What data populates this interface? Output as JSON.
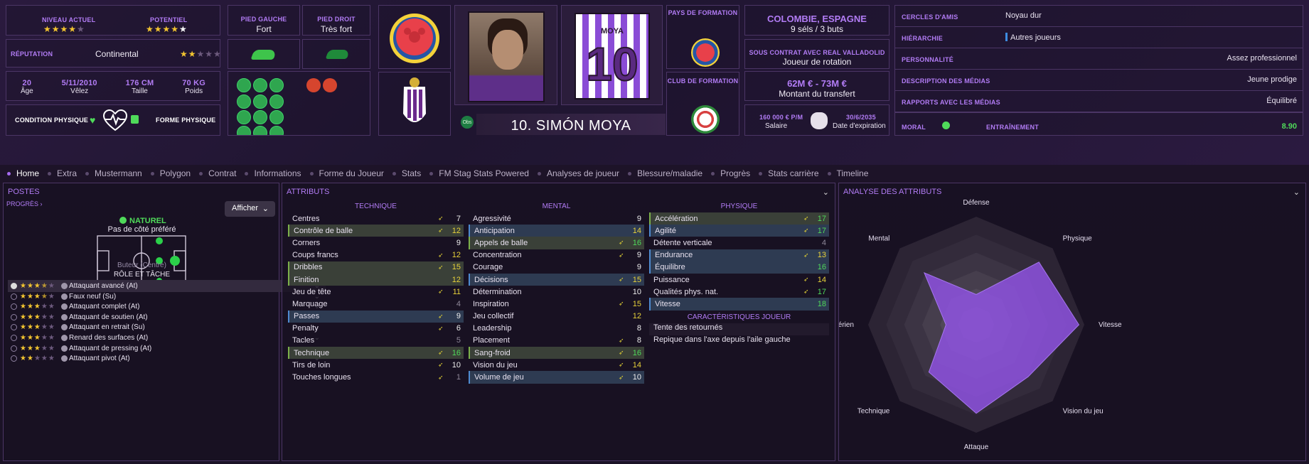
{
  "player": {
    "name": "10. SIMÓN MOYA",
    "shirt_name": "MOYA",
    "shirt_number": "10",
    "obs": "Obs"
  },
  "ability": {
    "current_label": "NIVEAU ACTUEL",
    "current_stars": 3.5,
    "potential_label": "POTENTIEL",
    "potential_stars": 4.5
  },
  "reputation": {
    "label": "RÉPUTATION",
    "value": "Continental",
    "stars": 2.5
  },
  "bio": [
    {
      "value": "20",
      "label": "Âge"
    },
    {
      "value": "5/11/2010",
      "label": "Vêlez"
    },
    {
      "value": "176 CM",
      "label": "Taille"
    },
    {
      "value": "70 KG",
      "label": "Poids"
    }
  ],
  "condition": {
    "label": "CONDITION PHYSIQUE",
    "form_label": "FORME PHYSIQUE"
  },
  "feet": {
    "left_label": "PIED GAUCHE",
    "left_value": "Fort",
    "right_label": "PIED DROIT",
    "right_value": "Très fort"
  },
  "training": {
    "country_label": "PAYS DE FORMATION",
    "club_label": "CLUB DE FORMATION"
  },
  "international": {
    "nation": "COLOMBIE, ESPAGNE",
    "caps": "9 séls / 3 buts"
  },
  "contract": {
    "title": "SOUS CONTRAT AVEC REAL VALLADOLID",
    "role": "Joueur de rotation",
    "value": "62M € - 73M €",
    "value_label": "Montant du transfert",
    "wage": "160 000 € P/M",
    "wage_label": "Salaire",
    "expiry": "30/6/2035",
    "expiry_label": "Date d'expiration"
  },
  "personal": [
    {
      "label": "CERCLES D'AMIS",
      "value": "Noyau dur"
    },
    {
      "label": "HIÉRARCHIE",
      "value": "Autres joueurs"
    },
    {
      "label": "PERSONNALITÉ",
      "value": "Assez professionnel"
    },
    {
      "label": "DESCRIPTION DES MÉDIAS",
      "value": "Jeune prodige"
    },
    {
      "label": "RAPPORTS AVEC LES MÉDIAS",
      "value": "Équilibré"
    }
  ],
  "morale": {
    "label": "MORAL",
    "training_label": "ENTRAÎNEMENT",
    "training_value": "8.90"
  },
  "tabs": [
    "Home",
    "Extra",
    "Mustermann",
    "Polygon",
    "Contrat",
    "Informations",
    "Forme du Joueur",
    "Stats",
    "FM Stag Stats Powered",
    "Analyses de joueur",
    "Blessure/maladie",
    "Progrès",
    "Stats carrière",
    "Timeline"
  ],
  "positions": {
    "title": "POSTES",
    "progress": "PROGRÈS",
    "show_btn": "Afficher",
    "natural": "NATUREL",
    "side": "Pas de côté préféré",
    "position": "Buteur (Centre)",
    "role_title": "RÔLE ET TÂCHE"
  },
  "roles": [
    {
      "name": "Attaquant avancé (At)",
      "stars": 3.5,
      "selected": true
    },
    {
      "name": "Faux neuf (Su)",
      "stars": 3.5
    },
    {
      "name": "Attaquant complet (At)",
      "stars": 3
    },
    {
      "name": "Attaquant de soutien (At)",
      "stars": 3
    },
    {
      "name": "Attaquant en retrait (Su)",
      "stars": 3
    },
    {
      "name": "Renard des surfaces (At)",
      "stars": 3
    },
    {
      "name": "Attaquant de pressing (At)",
      "stars": 3
    },
    {
      "name": "Attaquant pivot (At)",
      "stars": 2
    }
  ],
  "attributes": {
    "title": "ATTRIBUTS",
    "technical_title": "TECHNIQUE",
    "mental_title": "MENTAL",
    "physical_title": "PHYSIQUE",
    "traits_title": "CARACTÉRISTIQUES JOUEUR",
    "technical": [
      {
        "n": "Centres",
        "v": "7",
        "a": 1,
        "c": "w"
      },
      {
        "n": "Contrôle de balle",
        "v": "12",
        "a": 1,
        "c": "y",
        "h": "g"
      },
      {
        "n": "Corners",
        "v": "9",
        "c": "w"
      },
      {
        "n": "Coups francs",
        "v": "12",
        "a": 1,
        "c": "y"
      },
      {
        "n": "Dribbles",
        "v": "15",
        "a": 1,
        "c": "y",
        "h": "g"
      },
      {
        "n": "Finition",
        "v": "12",
        "c": "y",
        "h": "g"
      },
      {
        "n": "Jeu de tête",
        "v": "11",
        "a": 1,
        "c": "y"
      },
      {
        "n": "Marquage",
        "v": "4",
        "c": "d"
      },
      {
        "n": "Passes",
        "v": "9",
        "a": 1,
        "c": "w",
        "h": "b"
      },
      {
        "n": "Penalty",
        "v": "6",
        "a": 1,
        "c": "w"
      },
      {
        "n": "Tacles",
        "v": "5",
        "c": "d"
      },
      {
        "n": "Technique",
        "v": "16",
        "a": 1,
        "c": "g",
        "h": "g"
      },
      {
        "n": "Tirs de loin",
        "v": "10",
        "a": 1,
        "c": "w"
      },
      {
        "n": "Touches longues",
        "v": "1",
        "a": 1,
        "c": "d"
      }
    ],
    "mental": [
      {
        "n": "Agressivité",
        "v": "9",
        "c": "w"
      },
      {
        "n": "Anticipation",
        "v": "14",
        "c": "y",
        "h": "b"
      },
      {
        "n": "Appels de balle",
        "v": "16",
        "a": 1,
        "c": "g",
        "h": "g"
      },
      {
        "n": "Concentration",
        "v": "9",
        "a": 1,
        "c": "w"
      },
      {
        "n": "Courage",
        "v": "9",
        "c": "w"
      },
      {
        "n": "Décisions",
        "v": "15",
        "a": 1,
        "c": "y",
        "h": "b"
      },
      {
        "n": "Détermination",
        "v": "10",
        "c": "w"
      },
      {
        "n": "Inspiration",
        "v": "15",
        "a": 1,
        "c": "y"
      },
      {
        "n": "Jeu collectif",
        "v": "12",
        "c": "y"
      },
      {
        "n": "Leadership",
        "v": "8",
        "c": "w"
      },
      {
        "n": "Placement",
        "v": "8",
        "a": 1,
        "c": "w"
      },
      {
        "n": "Sang-froid",
        "v": "16",
        "a": 1,
        "c": "g",
        "h": "g"
      },
      {
        "n": "Vision du jeu",
        "v": "14",
        "a": 1,
        "c": "y"
      },
      {
        "n": "Volume de jeu",
        "v": "10",
        "a": 1,
        "c": "w",
        "h": "b"
      }
    ],
    "physical": [
      {
        "n": "Accélération",
        "v": "17",
        "a": 1,
        "c": "g",
        "h": "g"
      },
      {
        "n": "Agilité",
        "v": "17",
        "a": 1,
        "c": "g",
        "h": "b"
      },
      {
        "n": "Détente verticale",
        "v": "4",
        "c": "d"
      },
      {
        "n": "Endurance",
        "v": "13",
        "a": 1,
        "c": "y",
        "h": "b"
      },
      {
        "n": "Équilibre",
        "v": "16",
        "c": "g",
        "h": "b"
      },
      {
        "n": "Puissance",
        "v": "14",
        "a": 1,
        "c": "y"
      },
      {
        "n": "Qualités phys. nat.",
        "v": "17",
        "a": 1,
        "c": "g"
      },
      {
        "n": "Vitesse",
        "v": "18",
        "c": "g",
        "h": "b"
      }
    ],
    "traits": [
      "Tente des retournés",
      "Repique dans l'axe depuis l'aile gauche"
    ]
  },
  "analysis": {
    "title": "ANALYSE DES ATTRIBUTS",
    "axes": [
      "Défense",
      "Physique",
      "Vitesse",
      "Vision du jeu",
      "Attaque",
      "Technique",
      "Jeu aérien",
      "Mental"
    ],
    "values": [
      0.28,
      0.82,
      0.95,
      0.68,
      0.82,
      0.62,
      0.28,
      0.68
    ],
    "color": "#8e52e0"
  },
  "colors": {
    "accent": "#b27cf5",
    "green": "#4fda5a",
    "yellow": "#e8d23a"
  }
}
